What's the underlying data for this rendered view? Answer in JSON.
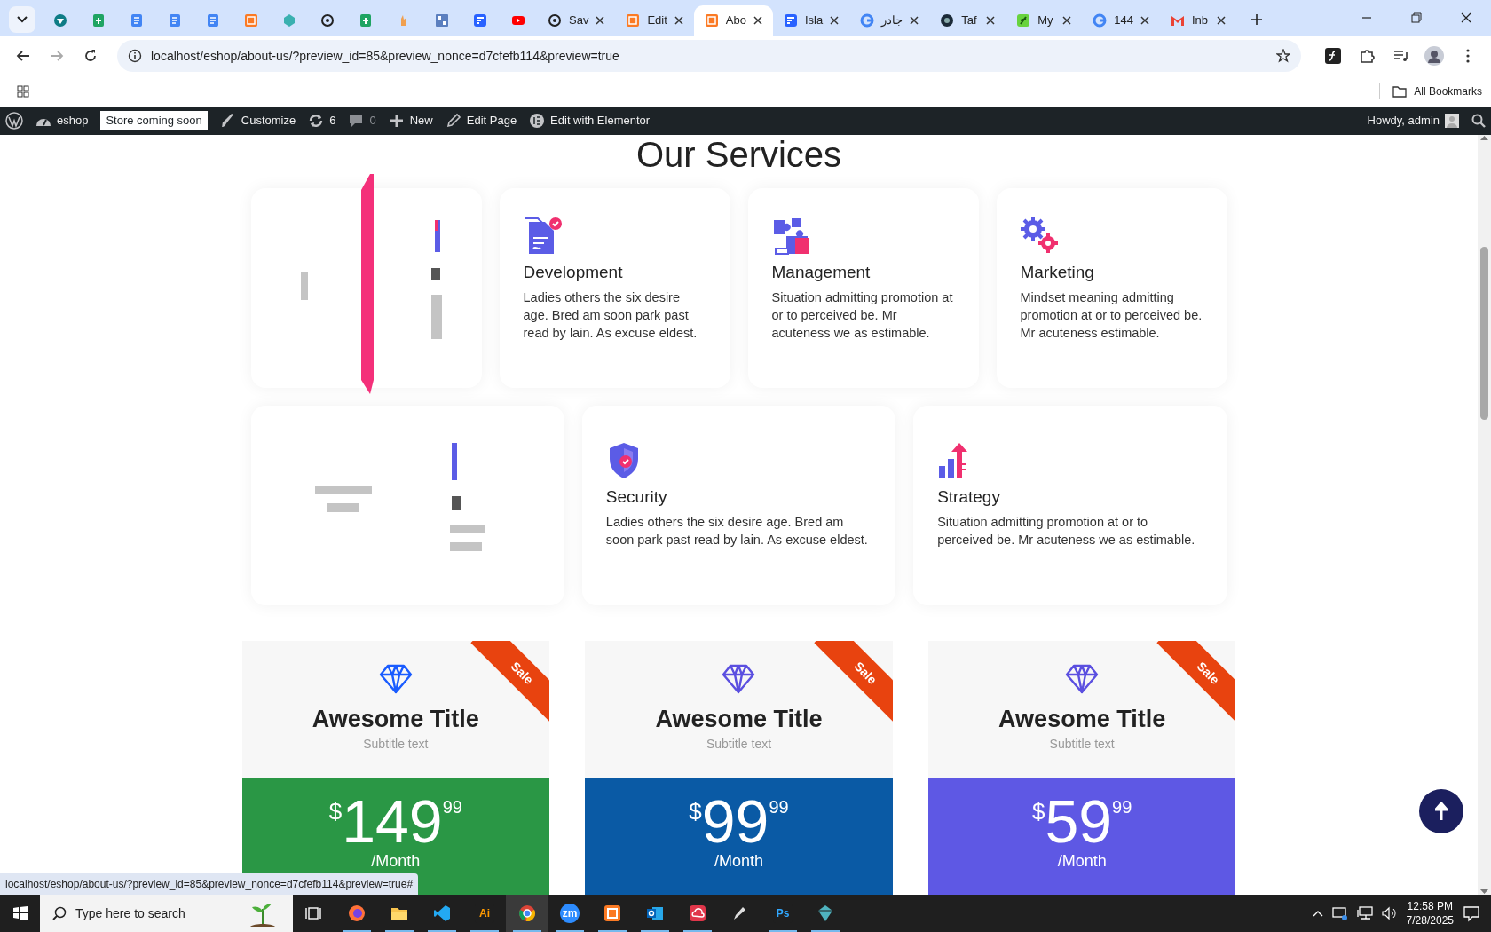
{
  "browser": {
    "tabs": [
      {
        "selected": false
      },
      {
        "selected": false
      },
      {
        "selected": false
      },
      {
        "selected": false
      },
      {
        "selected": false
      },
      {
        "selected": false
      },
      {
        "selected": false
      },
      {
        "selected": false
      },
      {
        "selected": false
      },
      {
        "selected": false
      },
      {
        "selected": false
      },
      {
        "selected": false
      },
      {
        "selected": false
      },
      {
        "title": "Sav",
        "selected": false
      },
      {
        "title": "Edit",
        "selected": false
      },
      {
        "title": "Abo",
        "selected": true
      },
      {
        "title": "Isla",
        "selected": false
      },
      {
        "title": "جادر",
        "selected": false
      },
      {
        "title": "Taf",
        "selected": false
      },
      {
        "title": "My",
        "selected": false
      },
      {
        "title": "144",
        "selected": false
      },
      {
        "title": "Inb",
        "selected": false
      }
    ],
    "address": "localhost/eshop/about-us/?preview_id=85&preview_nonce=d7cfefb114&preview=true",
    "bookmarks_label": "All Bookmarks"
  },
  "admin_bar": {
    "site": "eshop",
    "badge": "Store coming soon",
    "items": [
      {
        "kind": "customize",
        "label": "Customize"
      },
      {
        "kind": "updates",
        "label": "6"
      },
      {
        "kind": "comments",
        "label": "0"
      },
      {
        "kind": "new",
        "label": "New"
      },
      {
        "kind": "edit",
        "label": "Edit Page"
      },
      {
        "kind": "elementor",
        "label": "Edit with Elementor"
      }
    ],
    "greeting": "Howdy, admin"
  },
  "services": {
    "title": "Our Services",
    "top_row": [
      {
        "kind": "flipping"
      },
      {
        "kind": "card",
        "title": "Development",
        "text": "Ladies others the six desire age. Bred am soon park past read by lain. As excuse eldest."
      },
      {
        "kind": "card",
        "title": "Management",
        "text": "Situation admitting promotion at or to perceived be. Mr acuteness we as estimable."
      },
      {
        "kind": "card",
        "title": "Marketing",
        "text": "Mindset meaning admitting promotion at or to perceived be. Mr acuteness estimable."
      }
    ],
    "bottom_row": [
      {
        "kind": "flipping"
      },
      {
        "kind": "card",
        "title": "Security",
        "text": "Ladies others the six desire age. Bred am soon park past read by lain. As excuse eldest."
      },
      {
        "kind": "card",
        "title": "Strategy",
        "text": "Situation admitting promotion at or to perceived be. Mr acuteness we as estimable."
      }
    ]
  },
  "pricing": [
    {
      "badge": "Sale",
      "title": "Awesome Title",
      "subtitle": "Subtitle text",
      "currency": "$",
      "price": "149",
      "cents": "99",
      "period": "/Month",
      "color": "#2a9745"
    },
    {
      "badge": "Sale",
      "title": "Awesome Title",
      "subtitle": "Subtitle text",
      "currency": "$",
      "price": "99",
      "cents": "99",
      "period": "/Month",
      "color": "#0a5aa5"
    },
    {
      "badge": "Sale",
      "title": "Awesome Title",
      "subtitle": "Subtitle text",
      "currency": "$",
      "price": "59",
      "cents": "99",
      "period": "/Month",
      "color": "#5e58e4"
    }
  ],
  "status_url": "localhost/eshop/about-us/?preview_id=85&preview_nonce=d7cfefb114&preview=true#",
  "taskbar": {
    "search_placeholder": "Type here to search",
    "apps": [
      {
        "kind": "taskview",
        "running": false,
        "selected": false
      },
      {
        "kind": "firefox",
        "running": true,
        "selected": false
      },
      {
        "kind": "explorer",
        "running": true,
        "selected": false
      },
      {
        "kind": "vscode",
        "running": true,
        "selected": false
      },
      {
        "kind": "letters",
        "label": "Ai",
        "running": true,
        "selected": false
      },
      {
        "kind": "chrome",
        "running": true,
        "selected": true
      },
      {
        "kind": "zoom",
        "label": "zm",
        "running": true,
        "selected": false
      },
      {
        "kind": "xampp",
        "running": true,
        "selected": false
      },
      {
        "kind": "outlook",
        "running": true,
        "selected": false
      },
      {
        "kind": "cloud",
        "running": true,
        "selected": false
      },
      {
        "kind": "pen",
        "running": false,
        "selected": false
      },
      {
        "kind": "letters",
        "label": "Ps",
        "running": true,
        "selected": false
      },
      {
        "kind": "gem",
        "running": true,
        "selected": false
      }
    ],
    "time": "12:58 PM",
    "date": "7/28/2025"
  }
}
